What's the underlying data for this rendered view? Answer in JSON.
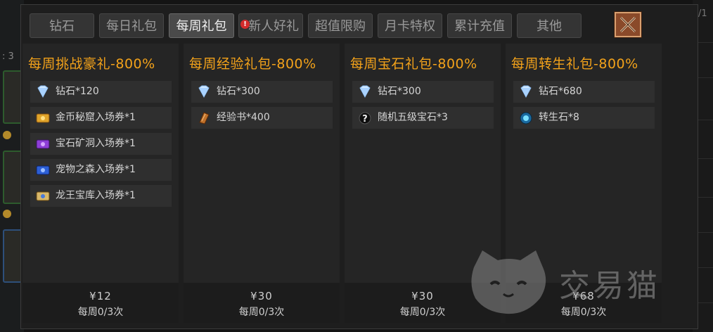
{
  "background": {
    "left_label": ": 3",
    "right_label": "/1"
  },
  "tabs": [
    {
      "label": "钻石",
      "active": false
    },
    {
      "label": "每日礼包",
      "active": false
    },
    {
      "label": "每周礼包",
      "active": true
    },
    {
      "label": "新人好礼",
      "active": false,
      "badge": "!"
    },
    {
      "label": "超值限购",
      "active": false
    },
    {
      "label": "月卡特权",
      "active": false
    },
    {
      "label": "累计充值",
      "active": false
    },
    {
      "label": "其他",
      "active": false
    }
  ],
  "packs": [
    {
      "title": "每周挑战豪礼-800%",
      "items": [
        {
          "icon": "diamond-icon",
          "label": "钻石*120"
        },
        {
          "icon": "gold-ticket-icon",
          "label": "金币秘窟入场券*1"
        },
        {
          "icon": "purple-ticket-icon",
          "label": "宝石矿洞入场券*1"
        },
        {
          "icon": "blue-ticket-icon",
          "label": "宠物之森入场券*1"
        },
        {
          "icon": "dragon-ticket-icon",
          "label": "龙王宝库入场券*1"
        }
      ],
      "price": "¥12",
      "limit": "每周0/3次"
    },
    {
      "title": "每周经验礼包-800%",
      "items": [
        {
          "icon": "diamond-icon",
          "label": "钻石*300"
        },
        {
          "icon": "exp-book-icon",
          "label": "经验书*400"
        }
      ],
      "price": "¥30",
      "limit": "每周0/3次"
    },
    {
      "title": "每周宝石礼包-800%",
      "items": [
        {
          "icon": "diamond-icon",
          "label": "钻石*300"
        },
        {
          "icon": "mystery-gem-icon",
          "label": "随机五级宝石*3"
        }
      ],
      "price": "¥30",
      "limit": "每周0/3次"
    },
    {
      "title": "每周转生礼包-800%",
      "items": [
        {
          "icon": "diamond-icon",
          "label": "钻石*680"
        },
        {
          "icon": "rebirth-stone-icon",
          "label": "转生石*8"
        }
      ],
      "price": "¥68",
      "limit": "每周0/3次"
    }
  ],
  "watermark": {
    "text": "交易猫"
  },
  "colors": {
    "title": "#f3a21a",
    "panel": "#1e1e1e",
    "column": "#252525",
    "tab_active": "#4a4a4a"
  }
}
